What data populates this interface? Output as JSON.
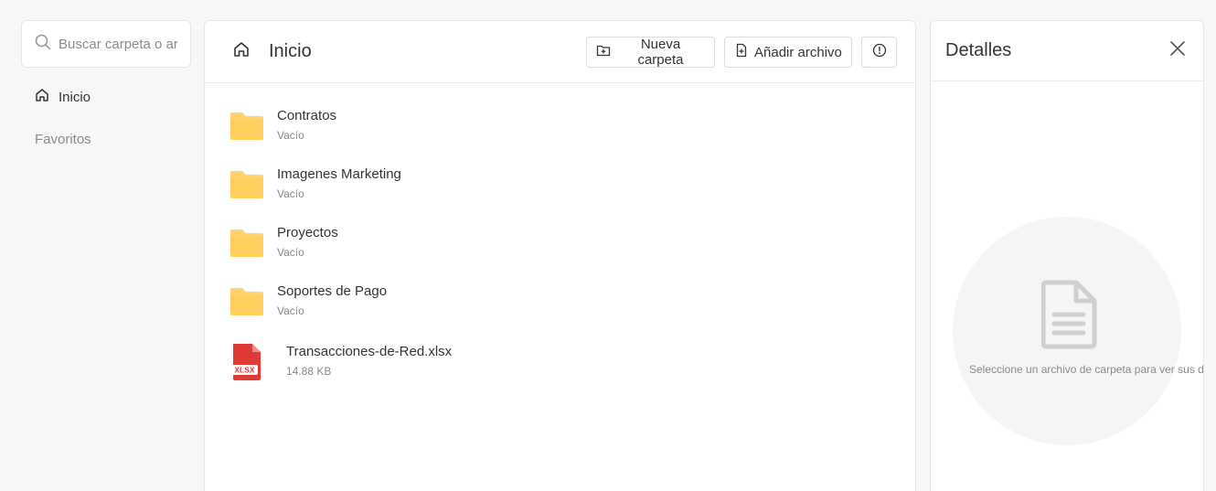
{
  "sidebar": {
    "search_placeholder": "Buscar carpeta o archivo",
    "items": [
      {
        "label": "Inicio"
      },
      {
        "label": "Favoritos"
      }
    ]
  },
  "main": {
    "title": "Inicio",
    "buttons": {
      "new_folder": "Nueva carpeta",
      "add_file": "Añadir archivo"
    },
    "items": [
      {
        "name": "Contratos",
        "meta": "Vacío",
        "icon": "folder-icon"
      },
      {
        "name": "Imagenes Marketing",
        "meta": "Vacío",
        "icon": "folder-icon"
      },
      {
        "name": "Proyectos",
        "meta": "Vacío",
        "icon": "folder-icon"
      },
      {
        "name": "Soportes de Pago",
        "meta": "Vacío",
        "icon": "folder-icon"
      },
      {
        "name": "Transacciones-de-Red.xlsx",
        "meta": "14.88 KB",
        "icon": "xlsx-file-icon",
        "badge": "XLSX"
      }
    ]
  },
  "details": {
    "title": "Detalles",
    "empty_text": "Seleccione un archivo de carpeta para ver sus detalles"
  },
  "colors": {
    "folder": "#ffd46b",
    "xlsx": "#e03a36",
    "icon_gray": "#d0d0d0"
  }
}
